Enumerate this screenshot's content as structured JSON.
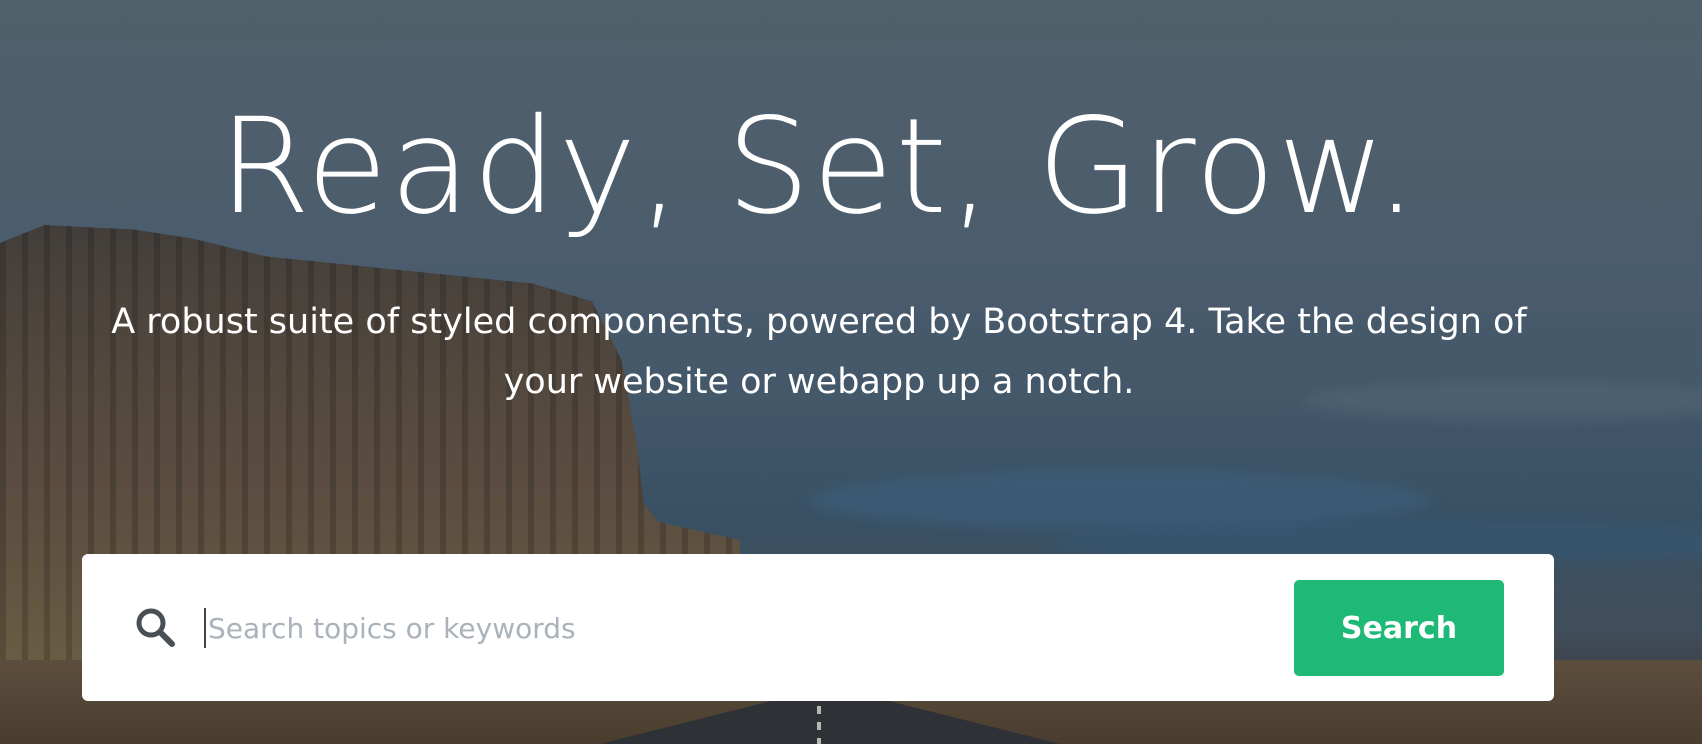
{
  "hero": {
    "headline": "Ready, Set, Grow.",
    "subtitle": "A robust suite of styled components, powered by Bootstrap 4. Take the design of your website or webapp up a notch."
  },
  "search": {
    "icon": "search-icon",
    "value": "",
    "placeholder": "Search topics or keywords",
    "button_label": "Search",
    "button_color": "#1eb977"
  }
}
